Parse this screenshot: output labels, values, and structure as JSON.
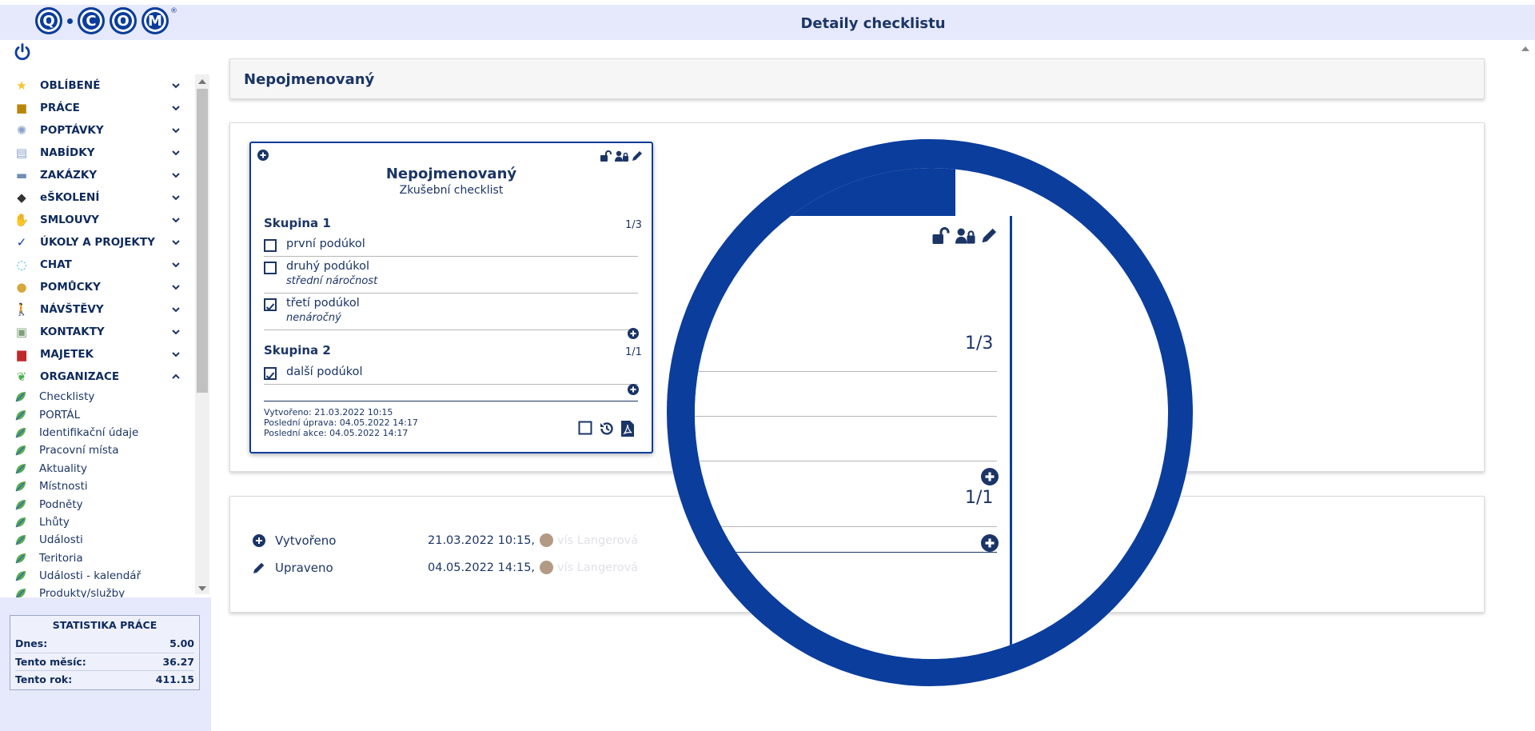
{
  "header": {
    "title": "Detaily checklistu",
    "logo_letters": [
      "Q",
      "C",
      "O",
      "M"
    ],
    "logo_registered": "®"
  },
  "sidebar": {
    "menu": [
      {
        "label": "OBLÍBENÉ",
        "icon": "star-icon",
        "glyph": "★",
        "color": "#f4c430"
      },
      {
        "label": "PRÁCE",
        "icon": "briefcase-icon",
        "glyph": "■",
        "color": "#b8860b"
      },
      {
        "label": "POPTÁVKY",
        "icon": "lightbulb-icon",
        "glyph": "✺",
        "color": "#8aa2c8"
      },
      {
        "label": "NABÍDKY",
        "icon": "clipboard-icon",
        "glyph": "▤",
        "color": "#8aa2c8"
      },
      {
        "label": "ZAKÁZKY",
        "icon": "toolbox-icon",
        "glyph": "▬",
        "color": "#6f8fb3"
      },
      {
        "label": "eŠKOLENÍ",
        "icon": "graduation-cap-icon",
        "glyph": "◆",
        "color": "#333333"
      },
      {
        "label": "SMLOUVY",
        "icon": "handshake-icon",
        "glyph": "✋",
        "color": "#8aa2c8"
      },
      {
        "label": "ÚKOLY A PROJEKTY",
        "icon": "task-clipboard-icon",
        "glyph": "✓",
        "color": "#0b3d9c"
      },
      {
        "label": "CHAT",
        "icon": "chat-bubble-icon",
        "glyph": "◌",
        "color": "#37b3d8"
      },
      {
        "label": "POMŮCKY",
        "icon": "coins-icon",
        "glyph": "●",
        "color": "#d6a73a"
      },
      {
        "label": "NÁVŠTĚVY",
        "icon": "walking-person-icon",
        "glyph": "🚶",
        "color": "#0b3d9c"
      },
      {
        "label": "KONTAKTY",
        "icon": "contact-card-icon",
        "glyph": "▣",
        "color": "#7fa07a"
      },
      {
        "label": "MAJETEK",
        "icon": "armchair-icon",
        "glyph": "▆",
        "color": "#c0282a"
      },
      {
        "label": "ORGANIZACE",
        "icon": "org-leaf-icon",
        "glyph": "❦",
        "color": "#4caf50"
      }
    ],
    "submenu": [
      "Checklisty",
      "PORTÁL",
      "Identifikační údaje",
      "Pracovní místa",
      "Aktuality",
      "Místnosti",
      "Podněty",
      "Lhůty",
      "Události",
      "Teritoria",
      "Události - kalendář",
      "Produkty/služby"
    ],
    "stats": {
      "title": "STATISTIKA PRÁCE",
      "rows": [
        {
          "label": "Dnes:",
          "value": "5.00"
        },
        {
          "label": "Tento měsíc:",
          "value": "36.27"
        },
        {
          "label": "Tento rok:",
          "value": "411.15"
        }
      ]
    }
  },
  "checklist": {
    "name": "Nepojmenovaný",
    "subtitle": "Zkušební checklist",
    "groups": [
      {
        "name": "Skupina 1",
        "count": "1/3",
        "tasks": [
          {
            "label": "první podúkol",
            "note": "",
            "checked": false
          },
          {
            "label": "druhý podúkol",
            "note": "střední náročnost",
            "checked": false
          },
          {
            "label": "třetí podúkol",
            "note": "nenáročný",
            "checked": true
          }
        ]
      },
      {
        "name": "Skupina 2",
        "count": "1/1",
        "tasks": [
          {
            "label": "další podúkol",
            "note": "",
            "checked": true
          }
        ]
      }
    ],
    "meta": {
      "created": "Vytvořeno: 21.03.2022 10:15",
      "edited": "Poslední úprava: 04.05.2022 14:17",
      "action": "Poslední akce: 04.05.2022 14:17"
    }
  },
  "history": [
    {
      "label": "Vytvořeno",
      "icon": "plus-circle-icon",
      "date": "21.03.2022 10:15,",
      "user": "vís Langerová"
    },
    {
      "label": "Upraveno",
      "icon": "pencil-icon",
      "date": "04.05.2022 14:15,",
      "user": "vís Langerová"
    }
  ],
  "colors": {
    "brand": "#0b3d9c",
    "text": "#1b3566",
    "header_bg": "#e6e9fb"
  }
}
